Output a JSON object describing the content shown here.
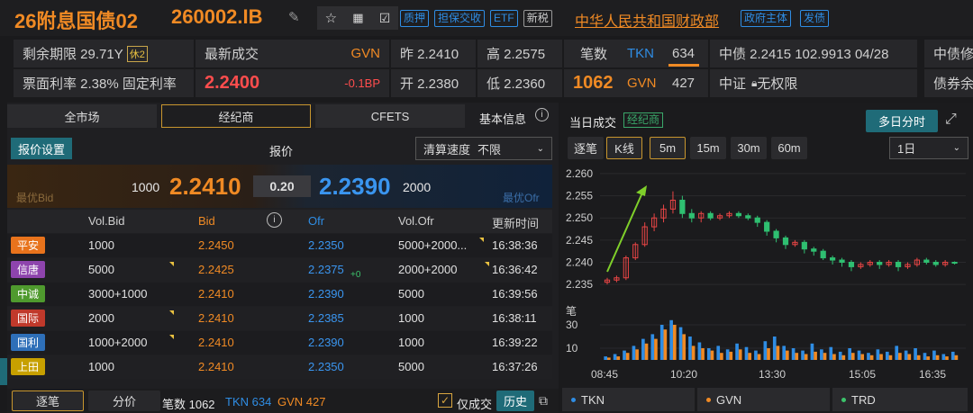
{
  "header": {
    "bond_name": "26附息国债02",
    "bond_code": "260002.IB",
    "tags": [
      "质押",
      "担保交收",
      "ETF",
      "新税"
    ],
    "issuer": "中华人民共和国财政部",
    "issuer_tags": [
      "政府主体",
      "发债"
    ]
  },
  "info": {
    "remaining_term": "剩余期限 29.71Y",
    "holiday_badge": "休2",
    "latest_trade_label": "最新成交",
    "latest_source": "GVN",
    "prev_close": "昨 2.2410",
    "high": "高 2.2575",
    "coupon": "票面利率 2.38% 固定利率",
    "latest_price": "2.2400",
    "change": "-0.1BP",
    "open": "开 2.2380",
    "low": "低 2.2360",
    "deals_label": "笔数",
    "tkn_label": "TKN",
    "tkn_count": "634",
    "deals_total": "1062",
    "gvn_label": "GVN",
    "gvn_count": "427",
    "cdb_valuation": "中债 2.2415 102.9913 04/28",
    "cdb_extra": "中债修",
    "csi_valuation": "中证",
    "csi_rights": "无权限",
    "bond_extra": "债券余"
  },
  "left": {
    "tabs": [
      "全市场",
      "经纪商",
      "CFETS"
    ],
    "basic_info": "基本信息",
    "quote_settings": "报价设置",
    "quote_label": "报价",
    "clear_speed_label": "清算速度",
    "clear_speed_value": "不限",
    "best_bid_label": "最优Bid",
    "best_bid_vol": "1000",
    "best_bid": "2.2410",
    "spread": "0.20",
    "best_ofr": "2.2390",
    "best_ofr_vol": "2000",
    "best_ofr_label": "最优Ofr",
    "columns": [
      "Vol.Bid",
      "Bid",
      "Ofr",
      "Vol.Ofr",
      "更新时间"
    ],
    "rows": [
      {
        "broker": "平安",
        "color": "#e8731c",
        "vol_bid": "1000",
        "bid": "2.2450",
        "ofr": "2.2350",
        "ofr_sup": "",
        "vol_ofr": "5000+2000...",
        "time": "16:38:36"
      },
      {
        "broker": "信唐",
        "color": "#8e44ad",
        "vol_bid": "5000",
        "bid": "2.2425",
        "ofr": "2.2375",
        "ofr_sup": "+0",
        "vol_ofr": "2000+2000",
        "time": "16:36:42"
      },
      {
        "broker": "中诚",
        "color": "#4f9a2e",
        "vol_bid": "3000+1000",
        "bid": "2.2410",
        "ofr": "2.2390",
        "ofr_sup": "",
        "vol_ofr": "5000",
        "time": "16:39:56"
      },
      {
        "broker": "国际",
        "color": "#c0392b",
        "vol_bid": "2000",
        "bid": "2.2410",
        "ofr": "2.2385",
        "ofr_sup": "",
        "vol_ofr": "1000",
        "time": "16:38:11"
      },
      {
        "broker": "国利",
        "color": "#2e6fb8",
        "vol_bid": "1000+2000",
        "bid": "2.2410",
        "ofr": "2.2390",
        "ofr_sup": "",
        "vol_ofr": "1000",
        "time": "16:39:22"
      },
      {
        "broker": "上田",
        "color": "#c7a000",
        "vol_bid": "1000",
        "bid": "2.2410",
        "ofr": "2.2350",
        "ofr_sup": "",
        "vol_ofr": "5000",
        "time": "16:37:26"
      }
    ],
    "footer": {
      "tab_tick": "逐笔",
      "tab_price": "分价",
      "deals": "笔数 1062",
      "tkn": "TKN 634",
      "gvn": "GVN 427",
      "only_deal": "仅成交",
      "history": "历史"
    }
  },
  "right": {
    "title": "当日成交",
    "broker_tag": "经纪商",
    "multi_day": "多日分时",
    "view_tabs": [
      "逐笔",
      "K线"
    ],
    "intervals": [
      "5m",
      "15m",
      "30m",
      "60m"
    ],
    "range_value": "1日",
    "volume_label": "笔",
    "legend": [
      "TKN",
      "GVN",
      "TRD"
    ]
  },
  "colors": {
    "accent_orange": "#f08a24",
    "accent_blue": "#2f8de4",
    "up_red": "#e84545",
    "down_green": "#2fbf71",
    "teal_button": "#1c6b72"
  },
  "chart_data": {
    "type": "candlestick",
    "interval": "5m",
    "y_ticks": [
      "2.260",
      "2.255",
      "2.250",
      "2.245",
      "2.240",
      "2.235"
    ],
    "ylim": [
      2.233,
      2.261
    ],
    "x_ticks": [
      "08:45",
      "10:20",
      "13:30",
      "15:05",
      "16:35"
    ],
    "candles": [
      [
        2.2355,
        2.236,
        2.235,
        2.2365
      ],
      [
        2.236,
        2.2365,
        2.2355,
        2.237
      ],
      [
        2.2365,
        2.241,
        2.236,
        2.2415
      ],
      [
        2.241,
        2.244,
        2.2405,
        2.2445
      ],
      [
        2.244,
        2.248,
        2.2435,
        2.249
      ],
      [
        2.248,
        2.25,
        2.247,
        2.251
      ],
      [
        2.25,
        2.252,
        2.249,
        2.253
      ],
      [
        2.252,
        2.254,
        2.251,
        2.256
      ],
      [
        2.254,
        2.251,
        2.25,
        2.255
      ],
      [
        2.251,
        2.25,
        2.249,
        2.252
      ],
      [
        2.25,
        2.251,
        2.249,
        2.2515
      ],
      [
        2.251,
        2.25,
        2.2495,
        2.2515
      ],
      [
        2.25,
        2.2505,
        2.2495,
        2.251
      ],
      [
        2.2505,
        2.251,
        2.25,
        2.2515
      ],
      [
        2.251,
        2.2505,
        2.25,
        2.2515
      ],
      [
        2.2505,
        2.25,
        2.2495,
        2.251
      ],
      [
        2.25,
        2.249,
        2.248,
        2.2505
      ],
      [
        2.249,
        2.247,
        2.246,
        2.2495
      ],
      [
        2.247,
        2.2455,
        2.2445,
        2.2475
      ],
      [
        2.2455,
        2.244,
        2.243,
        2.246
      ],
      [
        2.244,
        2.2445,
        2.2435,
        2.245
      ],
      [
        2.2445,
        2.243,
        2.242,
        2.245
      ],
      [
        2.243,
        2.2425,
        2.2415,
        2.2435
      ],
      [
        2.2425,
        2.241,
        2.2405,
        2.243
      ],
      [
        2.241,
        2.2405,
        2.2395,
        2.2415
      ],
      [
        2.2405,
        2.24,
        2.239,
        2.241
      ],
      [
        2.24,
        2.239,
        2.238,
        2.2405
      ],
      [
        2.239,
        2.2395,
        2.2385,
        2.24
      ],
      [
        2.2395,
        2.24,
        2.239,
        2.2405
      ],
      [
        2.24,
        2.2395,
        2.2385,
        2.2405
      ],
      [
        2.2395,
        2.24,
        2.239,
        2.2405
      ],
      [
        2.24,
        2.239,
        2.238,
        2.2405
      ],
      [
        2.239,
        2.2395,
        2.2385,
        2.24
      ],
      [
        2.2395,
        2.2405,
        2.239,
        2.241
      ],
      [
        2.2405,
        2.24,
        2.2395,
        2.241
      ],
      [
        2.24,
        2.2395,
        2.239,
        2.2405
      ],
      [
        2.2395,
        2.24,
        2.239,
        2.2405
      ],
      [
        2.24,
        2.2398,
        2.2395,
        2.2402
      ]
    ],
    "volume_series": [
      {
        "name": "TKN",
        "values": [
          3,
          5,
          8,
          12,
          18,
          22,
          30,
          34,
          28,
          20,
          15,
          10,
          12,
          9,
          14,
          11,
          8,
          16,
          20,
          12,
          10,
          8,
          14,
          9,
          11,
          7,
          10,
          8,
          6,
          9,
          7,
          12,
          8,
          10,
          6,
          8,
          5,
          7
        ]
      },
      {
        "name": "GVN",
        "values": [
          2,
          3,
          6,
          9,
          14,
          18,
          26,
          30,
          22,
          12,
          10,
          8,
          6,
          7,
          9,
          6,
          5,
          10,
          12,
          8,
          6,
          5,
          7,
          6,
          5,
          4,
          6,
          5,
          4,
          5,
          4,
          6,
          5,
          4,
          3,
          4,
          3,
          4
        ]
      }
    ],
    "volume_ylim": [
      0,
      40
    ],
    "volume_ticks": [
      "30",
      "10"
    ]
  }
}
